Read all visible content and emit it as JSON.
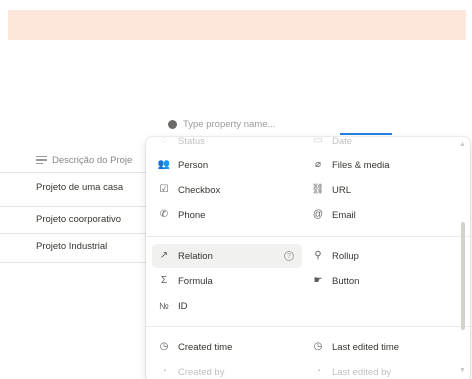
{
  "search": {
    "placeholder": "Type property name..."
  },
  "table": {
    "column_header": "Descrição do Proje",
    "rows": [
      "Projeto de uma casa",
      "Projeto coorporativo",
      "Projeto Industrial"
    ]
  },
  "menu": {
    "top_faded": {
      "left": "Status",
      "right": "Date"
    },
    "groups": [
      [
        {
          "left": {
            "label": "Person",
            "icon": "person-icon"
          },
          "right": {
            "label": "Files & media",
            "icon": "paperclip-icon"
          }
        },
        {
          "left": {
            "label": "Checkbox",
            "icon": "checkbox-icon"
          },
          "right": {
            "label": "URL",
            "icon": "link-icon"
          }
        },
        {
          "left": {
            "label": "Phone",
            "icon": "phone-icon"
          },
          "right": {
            "label": "Email",
            "icon": "at-icon"
          }
        }
      ],
      [
        {
          "left": {
            "label": "Relation",
            "icon": "arrow-up-right-icon",
            "highlighted": true
          },
          "right": {
            "label": "Rollup",
            "icon": "search-icon"
          }
        },
        {
          "left": {
            "label": "Formula",
            "icon": "sigma-icon"
          },
          "right": {
            "label": "Button",
            "icon": "cursor-click-icon"
          }
        },
        {
          "left": {
            "label": "ID",
            "icon": "numero-icon"
          }
        }
      ],
      [
        {
          "left": {
            "label": "Created time",
            "icon": "clock-icon"
          },
          "right": {
            "label": "Last edited time",
            "icon": "clock-icon"
          }
        },
        {
          "left": {
            "label": "Created by",
            "icon": "user-circle-icon",
            "faded": true
          },
          "right": {
            "label": "Last edited by",
            "icon": "user-circle-icon",
            "faded": true
          }
        }
      ]
    ]
  },
  "colors": {
    "accent": "#2383e2",
    "banner": "#fbe6d9",
    "highlight": "#f1f1ef"
  }
}
